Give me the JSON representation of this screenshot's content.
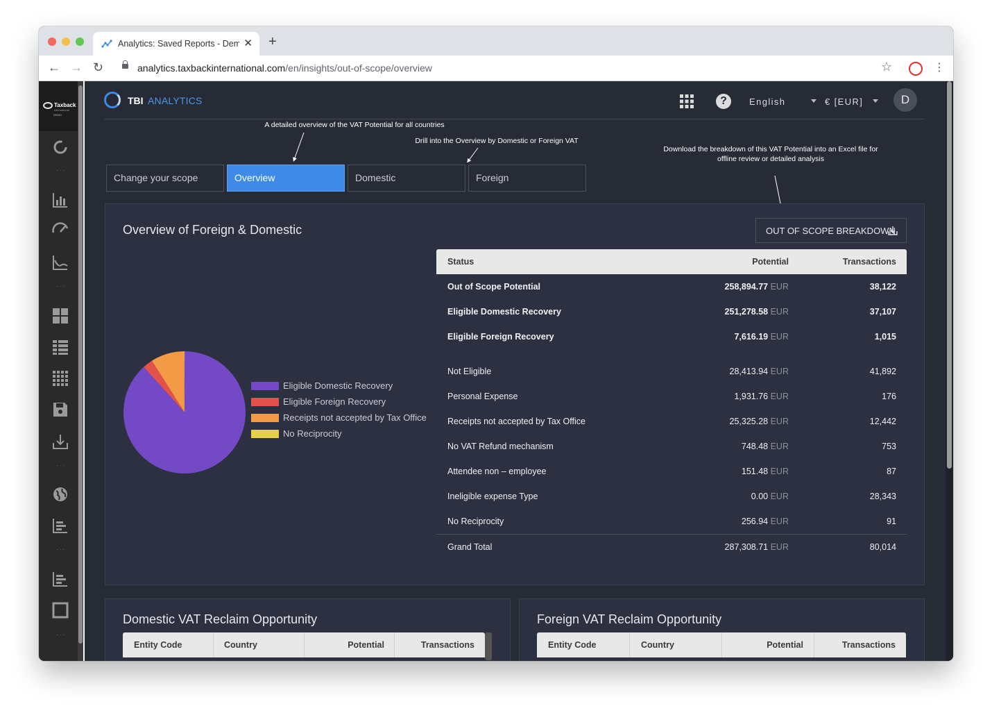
{
  "browser": {
    "tab_title": "Analytics: Saved Reports - Demo",
    "url_host": "analytics.taxbackinternational.com",
    "url_path": "/en/insights/out-of-scope/overview"
  },
  "sidebar": {
    "logo_text": "Taxback",
    "logo_sub": "international",
    "logo_demo": "DEMO",
    "icons": [
      "refresh-icon",
      "bar-chart-icon",
      "gauge-icon",
      "line-chart-icon",
      "dashboard-icon",
      "list-icon",
      "grid-icon",
      "save-icon",
      "download-icon",
      "globe-icon",
      "sort-chart-icon",
      "sort-chart-icon",
      "square-icon"
    ]
  },
  "header": {
    "brand_tbi": "TBI",
    "brand_analytics": "ANALYTICS",
    "language": "English",
    "currency": "€ [EUR]",
    "avatar_initial": "D",
    "help_label": "?"
  },
  "annotations": {
    "overview": "A detailed overview of the VAT  Potential for all countries",
    "drill": "Drill into the Overview by Domestic or Foreign VAT",
    "download_line1": "Download the breakdown of this VAT Potential into an Excel file for",
    "download_line2": "offline review or detailed analysis"
  },
  "scope_tabs": [
    "Change your scope",
    "Overview",
    "Domestic",
    "Foreign"
  ],
  "overview_card": {
    "title": "Overview of Foreign & Domestic",
    "download_button": "OUT OF SCOPE BREAKDOWN",
    "legend": [
      {
        "label": "Eligible Domestic Recovery",
        "color": "#7449c6"
      },
      {
        "label": "Eligible Foreign Recovery",
        "color": "#e3524a"
      },
      {
        "label": "Receipts not accepted by Tax Office",
        "color": "#f29a46"
      },
      {
        "label": "No Reciprocity",
        "color": "#e8d14a"
      }
    ],
    "table": {
      "headers": {
        "status": "Status",
        "potential": "Potential",
        "transactions": "Transactions"
      },
      "currency_suffix": "EUR",
      "summary_rows": [
        {
          "status": "Out of Scope Potential",
          "potential": "258,894.77",
          "transactions": "38,122"
        },
        {
          "status": "Eligible Domestic Recovery",
          "potential": "251,278.58",
          "transactions": "37,107"
        },
        {
          "status": "Eligible Foreign Recovery",
          "potential": "7,616.19",
          "transactions": "1,015"
        }
      ],
      "detail_rows": [
        {
          "status": "Not Eligible",
          "potential": "28,413.94",
          "transactions": "41,892"
        },
        {
          "status": "Personal Expense",
          "potential": "1,931.76",
          "transactions": "176"
        },
        {
          "status": "Receipts not accepted by Tax Office",
          "potential": "25,325.28",
          "transactions": "12,442"
        },
        {
          "status": "No VAT Refund mechanism",
          "potential": "748.48",
          "transactions": "753"
        },
        {
          "status": "Attendee non – employee",
          "potential": "151.48",
          "transactions": "87"
        },
        {
          "status": "Ineligible expense Type",
          "potential": "0.00",
          "transactions": "28,343"
        },
        {
          "status": "No Reciprocity",
          "potential": "256.94",
          "transactions": "91"
        }
      ],
      "total": {
        "status": "Grand Total",
        "potential": "287,308.71",
        "transactions": "80,014"
      }
    }
  },
  "chart_data": {
    "type": "pie",
    "categories": [
      "Eligible Domestic Recovery",
      "Eligible Foreign Recovery",
      "Receipts not accepted by Tax Office",
      "No Reciprocity"
    ],
    "values": [
      251278.58,
      7616.19,
      25325.28,
      256.94
    ],
    "colors": [
      "#7449c6",
      "#e3524a",
      "#f29a46",
      "#e8d14a"
    ],
    "legend_position": "right"
  },
  "domestic_card": {
    "title": "Domestic VAT Reclaim Opportunity",
    "headers": [
      "Entity Code",
      "Country",
      "Potential",
      "Transactions"
    ]
  },
  "foreign_card": {
    "title": "Foreign VAT Reclaim Opportunity",
    "headers": [
      "Entity Code",
      "Country",
      "Potential",
      "Transactions"
    ]
  }
}
